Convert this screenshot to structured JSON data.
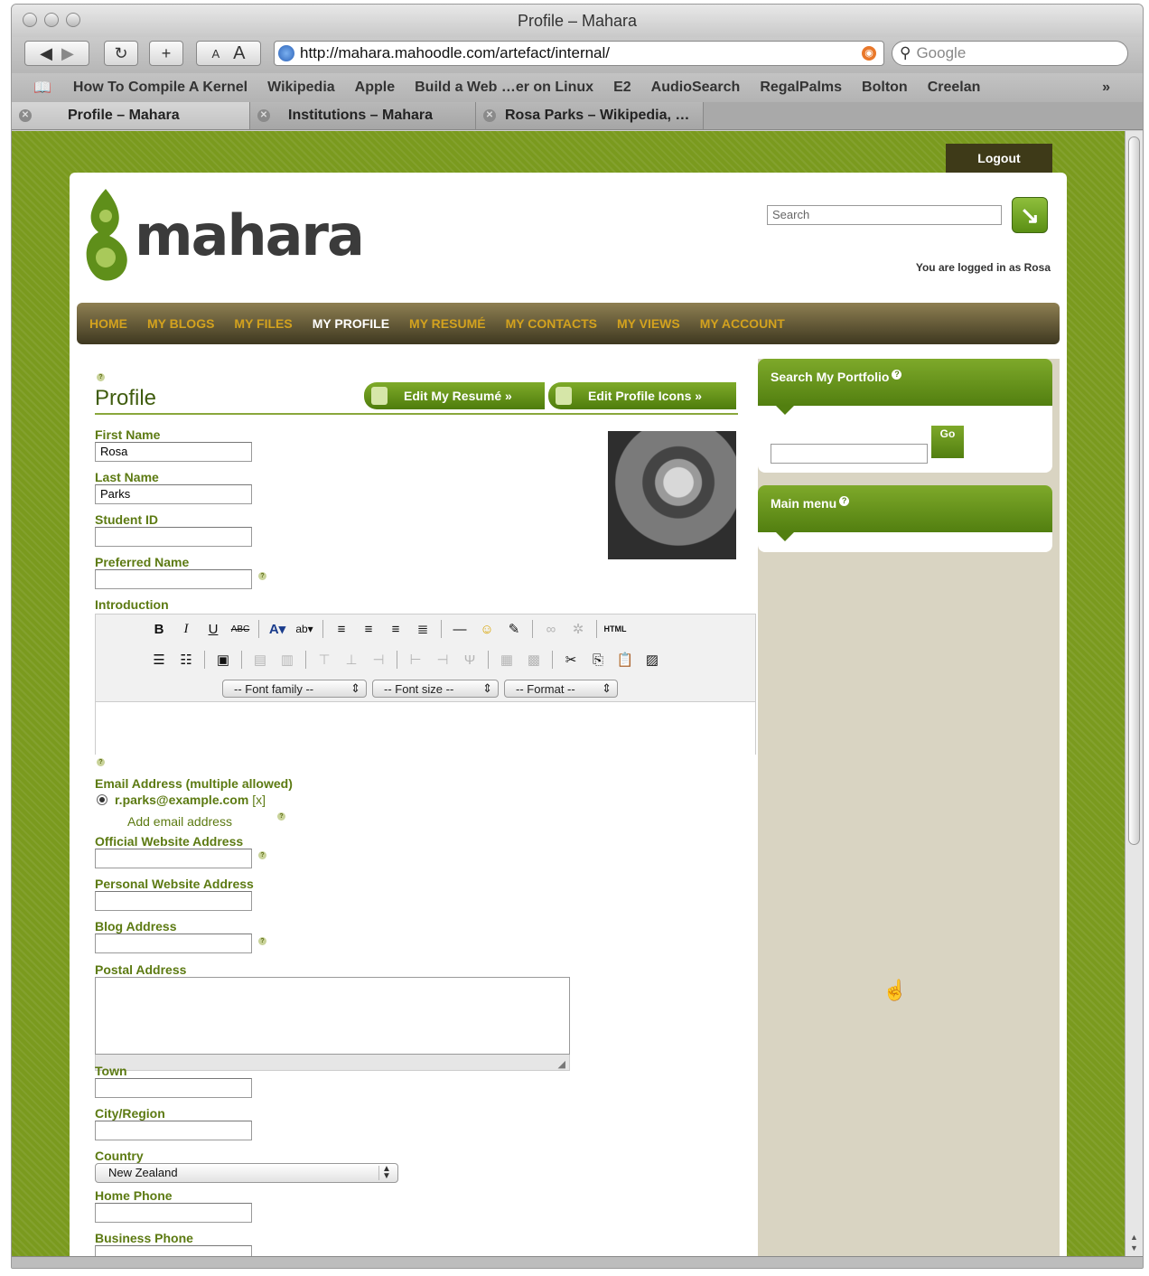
{
  "browser": {
    "window_title": "Profile – Mahara",
    "url": "http://mahara.mahoodle.com/artefact/internal/",
    "search_placeholder": "Google",
    "text_size_small": "A",
    "text_size_large": "A",
    "bookmarks": [
      "How To Compile A Kernel",
      "Wikipedia",
      "Apple",
      "Build a Web …er on Linux",
      "E2",
      "AudioSearch",
      "RegalPalms",
      "Bolton",
      "Creelan"
    ],
    "bookmarks_more": "»",
    "tabs": [
      {
        "label": "Profile – Mahara"
      },
      {
        "label": "Institutions – Mahara"
      },
      {
        "label": "Rosa Parks – Wikipedia, …"
      }
    ]
  },
  "header": {
    "logout_label": "Logout",
    "logo_text": "mahara",
    "search_placeholder": "Search",
    "logged_in_text": "You are logged in as Rosa"
  },
  "nav": {
    "items": [
      "HOME",
      "MY BLOGS",
      "MY FILES",
      "MY PROFILE",
      "MY RESUMÉ",
      "MY CONTACTS",
      "MY VIEWS",
      "MY ACCOUNT"
    ],
    "current": "MY PROFILE"
  },
  "profile": {
    "title": "Profile",
    "edit_resume_button": "Edit My Resumé »",
    "edit_icons_button": "Edit Profile Icons »",
    "fields": {
      "first_name_label": "First Name",
      "first_name_value": "Rosa",
      "last_name_label": "Last Name",
      "last_name_value": "Parks",
      "student_id_label": "Student ID",
      "student_id_value": "",
      "preferred_name_label": "Preferred Name",
      "preferred_name_value": "",
      "introduction_label": "Introduction",
      "email_label": "Email Address (multiple allowed)",
      "email_value": "r.parks@example.com",
      "email_remove": "[x]",
      "add_email": "Add email address",
      "official_website_label": "Official Website Address",
      "personal_website_label": "Personal Website Address",
      "blog_address_label": "Blog Address",
      "postal_address_label": "Postal Address",
      "town_label": "Town",
      "city_region_label": "City/Region",
      "country_label": "Country",
      "country_value": "New Zealand",
      "home_phone_label": "Home Phone",
      "business_phone_label": "Business Phone"
    },
    "editor": {
      "font_family": "-- Font family --",
      "font_size": "-- Font size --",
      "format": "-- Format --",
      "html_button": "HTML"
    }
  },
  "sidebar": {
    "search_portfolio_title": "Search My Portfolio",
    "go_label": "Go",
    "main_menu_title": "Main menu"
  },
  "colors": {
    "background_green": "#7a9a1e",
    "nav_dark": "#3e3820",
    "nav_link": "#d3a21e",
    "label_green": "#5c7a12",
    "sidebar_bg": "#d9d4c2"
  }
}
